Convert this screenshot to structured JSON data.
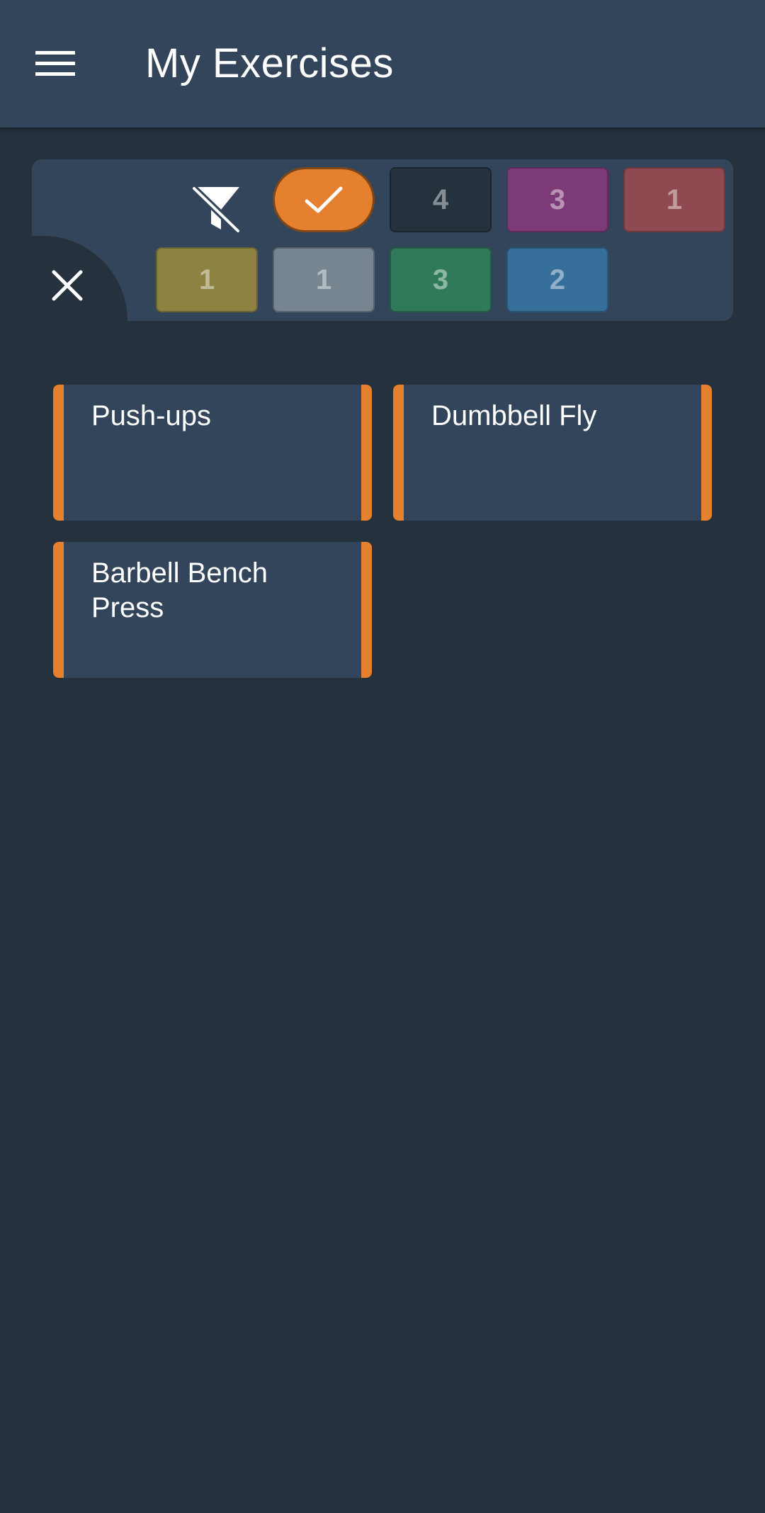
{
  "app_bar": {
    "title": "My Exercises",
    "menu_icon": "hamburger-menu-icon"
  },
  "filter_panel": {
    "close_icon": "close-icon",
    "filter_off_icon": "filter-off-icon",
    "selected_chip": {
      "icon": "check-icon",
      "color": "#e5802f"
    },
    "chips": [
      {
        "label": "4",
        "color": "#25313d"
      },
      {
        "label": "3",
        "color": "#7d3a79"
      },
      {
        "label": "1",
        "color": "#8e4a50"
      },
      {
        "label": "1",
        "color": "#8d8242"
      },
      {
        "label": "1",
        "color": "#76858f"
      },
      {
        "label": "3",
        "color": "#317a59"
      },
      {
        "label": "2",
        "color": "#376f9b"
      }
    ]
  },
  "exercises": [
    {
      "name": "Push-ups",
      "color": "#e5802f"
    },
    {
      "name": "Dumbbell Fly",
      "color": "#e5802f"
    },
    {
      "name": "Barbell Bench Press",
      "color": "#e5802f"
    }
  ]
}
